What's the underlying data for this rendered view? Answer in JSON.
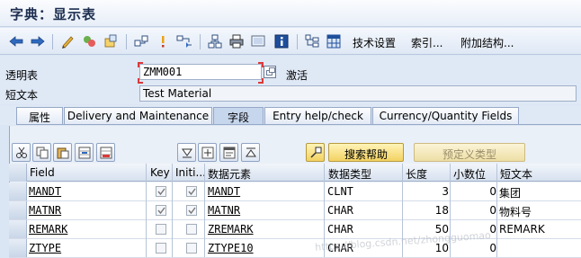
{
  "title": "字典：显示表",
  "toolbar": {
    "back_icon": "back-arrow-icon",
    "forward_icon": "forward-arrow-icon",
    "tech_settings": "技术设置",
    "index": "索引...",
    "append_structure": "附加结构..."
  },
  "header": {
    "table_label": "透明表",
    "table_value": "ZMM001",
    "status": "激活",
    "short_text_label": "短文本",
    "short_text_value": "Test Material"
  },
  "tabs": [
    {
      "label": "属性",
      "active": false
    },
    {
      "label": "Delivery and Maintenance",
      "active": false
    },
    {
      "label": "字段",
      "active": true
    },
    {
      "label": "Entry help/check",
      "active": false
    },
    {
      "label": "Currency/Quantity Fields",
      "active": false
    }
  ],
  "buttons": {
    "search_help": "搜索帮助",
    "predefined_type": "预定义类型"
  },
  "grid": {
    "columns": [
      "Field",
      "Key",
      "Initi...",
      "数据元素",
      "数据类型",
      "长度",
      "小数位",
      "短文本"
    ],
    "rows": [
      {
        "field": "MANDT",
        "key": true,
        "initial": true,
        "data_element": "MANDT",
        "data_type": "CLNT",
        "length": "3",
        "decimals": "0",
        "short_text": "集团"
      },
      {
        "field": "MATNR",
        "key": true,
        "initial": true,
        "data_element": "MATNR",
        "data_type": "CHAR",
        "length": "18",
        "decimals": "0",
        "short_text": "物料号"
      },
      {
        "field": "REMARK",
        "key": false,
        "initial": false,
        "data_element": "ZREMARK",
        "data_type": "CHAR",
        "length": "50",
        "decimals": "0",
        "short_text": "REMARK"
      },
      {
        "field": "ZTYPE",
        "key": false,
        "initial": false,
        "data_element": "ZTYPE10",
        "data_type": "CHAR",
        "length": "10",
        "decimals": "0",
        "short_text": ""
      }
    ]
  },
  "watermark": "https://blog.csdn.net/zhongguomao",
  "colors": {
    "accent": "#f3d262",
    "background": "#dbe6f4",
    "required_marker": "#d93a3a"
  }
}
